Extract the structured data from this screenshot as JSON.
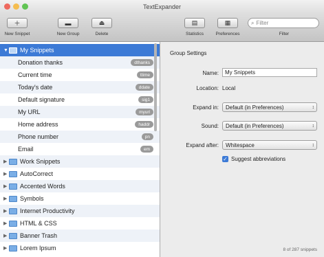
{
  "window": {
    "title": "TextExpander"
  },
  "toolbar": {
    "new_snippet": "New Snippet",
    "new_group": "New Group",
    "delete": "Delete",
    "statistics": "Statistics",
    "preferences": "Preferences",
    "filter_label": "Filter",
    "search_placeholder": "Filter"
  },
  "sidebar": {
    "groups": [
      {
        "label": "My Snippets",
        "expanded": true,
        "selected": true
      },
      {
        "label": "Work Snippets"
      },
      {
        "label": "AutoCorrect"
      },
      {
        "label": "Accented Words"
      },
      {
        "label": "Symbols"
      },
      {
        "label": "Internet Productivity"
      },
      {
        "label": "HTML & CSS"
      },
      {
        "label": "Banner Trash"
      },
      {
        "label": "Lorem Ipsum"
      }
    ],
    "snippets": [
      {
        "label": "Donation thanks",
        "abbr": "dthanks"
      },
      {
        "label": "Current time",
        "abbr": "ttime"
      },
      {
        "label": "Today's date",
        "abbr": "ddate"
      },
      {
        "label": "Default signature",
        "abbr": "sig1"
      },
      {
        "label": "My URL",
        "abbr": "myurl"
      },
      {
        "label": "Home address",
        "abbr": "haddr"
      },
      {
        "label": "Phone number",
        "abbr": "pn"
      },
      {
        "label": "Email",
        "abbr": "em"
      }
    ]
  },
  "panel": {
    "section_title": "Group Settings",
    "name_label": "Name:",
    "name_value": "My Snippets",
    "location_label": "Location:",
    "location_value": "Local",
    "expand_in_label": "Expand in:",
    "expand_in_value": "Default (in Preferences)",
    "sound_label": "Sound:",
    "sound_value": "Default (in Preferences)",
    "expand_after_label": "Expand after:",
    "expand_after_value": "Whitespace",
    "suggest_label": "Suggest abbreviations",
    "suggest_checked": true,
    "footer_count": "8 of 287 snippets"
  }
}
